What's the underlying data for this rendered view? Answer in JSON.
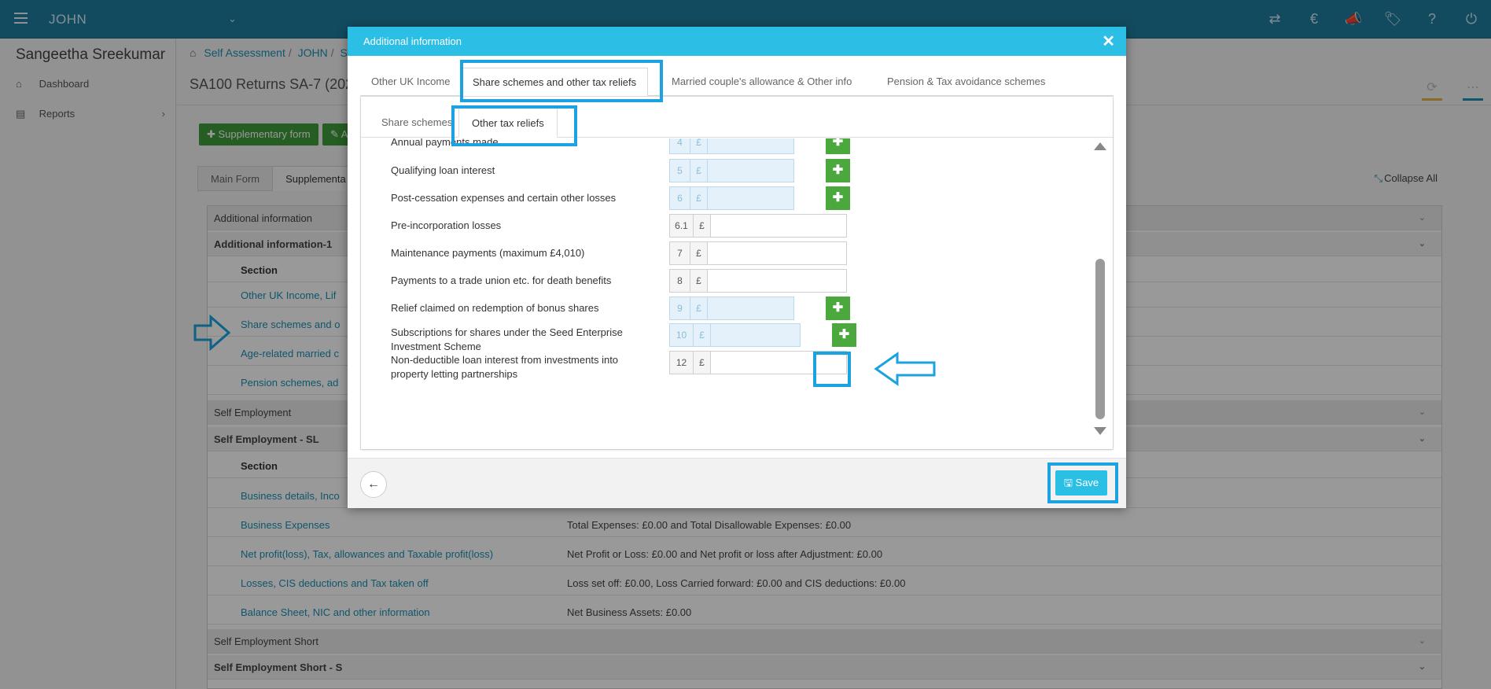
{
  "topbar": {
    "client": "JOHN",
    "caret": "⌄",
    "icons": [
      "⇄",
      "€",
      "📣",
      "🏷",
      "?",
      "⏻"
    ]
  },
  "sidebar": {
    "user": "Sangeetha Sreekumar",
    "items": [
      {
        "icon": "⌂",
        "label": "Dashboard"
      },
      {
        "icon": "▤",
        "label": "Reports",
        "chevron": "›"
      }
    ]
  },
  "main": {
    "breadcrumb": [
      "Self Assessment",
      "JOHN",
      "S"
    ],
    "page_title": "SA100 Returns SA-7 (2023",
    "buttons": {
      "supplementary": "✚ Supplementary form",
      "second": "✎ A"
    },
    "tabs": [
      "Main Form",
      "Supplementa"
    ],
    "collapse_all": "Collapse All",
    "rows": [
      {
        "type": "grey",
        "label": "Additional information"
      },
      {
        "type": "sub",
        "label": "Additional information-1"
      },
      {
        "type": "hdr",
        "label": "Section"
      },
      {
        "type": "link",
        "label": "Other UK Income, Lif",
        "value": ""
      },
      {
        "type": "link",
        "label": "Share schemes and o",
        "value": ""
      },
      {
        "type": "link",
        "label": "Age-related married c",
        "value": ""
      },
      {
        "type": "link",
        "label": "Pension schemes, ad",
        "value": ""
      },
      {
        "type": "grey",
        "label": "Self Employment"
      },
      {
        "type": "sub",
        "label": "Self Employment - SL"
      },
      {
        "type": "hdr",
        "label": "Section"
      },
      {
        "type": "link",
        "label": "Business details, Inco",
        "value": ""
      },
      {
        "type": "link",
        "label": "Business Expenses",
        "value": "Total Expenses: £0.00 and Total Disallowable Expenses: £0.00"
      },
      {
        "type": "link",
        "label": "Net profit(loss), Tax, allowances and Taxable profit(loss)",
        "value": "Net Profit or Loss: £0.00 and Net profit or loss after Adjustment: £0.00"
      },
      {
        "type": "link",
        "label": "Losses, CIS deductions and Tax taken off",
        "value": "Loss set off: £0.00, Loss Carried forward: £0.00 and CIS deductions: £0.00"
      },
      {
        "type": "link",
        "label": "Balance Sheet, NIC and other information",
        "value": "Net Business Assets: £0.00"
      },
      {
        "type": "grey",
        "label": "Self Employment Short"
      },
      {
        "type": "sub",
        "label": "Self Employment Short - S"
      }
    ]
  },
  "modal": {
    "title": "Additional information",
    "close": "✕",
    "tabs": [
      "Other UK Income",
      "Share schemes and other tax reliefs",
      "Married couple's allowance & Other info",
      "Pension & Tax avoidance schemes"
    ],
    "subtabs": [
      "Share schemes",
      "Other tax reliefs"
    ],
    "fields": [
      {
        "label": "Annual payments made",
        "box": "4",
        "currency": "£",
        "disabled": true,
        "plus": true
      },
      {
        "label": "Qualifying loan interest",
        "box": "5",
        "currency": "£",
        "disabled": true,
        "plus": true
      },
      {
        "label": "Post-cessation expenses and certain other losses",
        "box": "6",
        "currency": "£",
        "disabled": true,
        "plus": true
      },
      {
        "label": "Pre-incorporation losses",
        "box": "6.1",
        "currency": "£",
        "disabled": false,
        "plus": false
      },
      {
        "label": "Maintenance payments (maximum £4,010)",
        "box": "7",
        "currency": "£",
        "disabled": false,
        "plus": false
      },
      {
        "label": "Payments to a trade union etc. for death benefits",
        "box": "8",
        "currency": "£",
        "disabled": false,
        "plus": false
      },
      {
        "label": "Relief claimed on redemption of bonus shares",
        "box": "9",
        "currency": "£",
        "disabled": true,
        "plus": true
      },
      {
        "label": "Subscriptions for shares under the Seed Enterprise Investment Scheme",
        "box": "10",
        "currency": "£",
        "disabled": true,
        "plus": true
      },
      {
        "label": "Non-deductible loan interest from investments into property letting partnerships",
        "box": "12",
        "currency": "£",
        "disabled": false,
        "plus": false
      }
    ],
    "plus_glyph": "✚",
    "back": "←",
    "save": "Save"
  },
  "colors": {
    "topbar": "#1f7e9f",
    "accent": "#2cbfe6",
    "green": "#4aa83d",
    "highlight": "#1aa3e0",
    "link": "#1b8fb4"
  }
}
